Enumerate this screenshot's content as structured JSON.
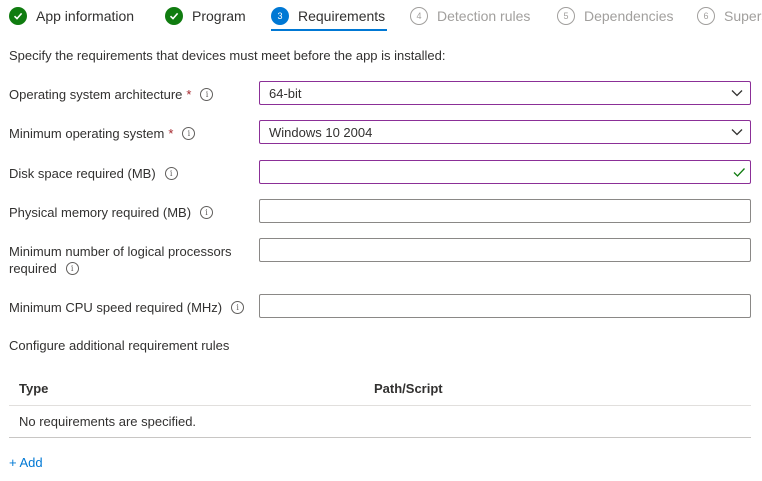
{
  "wizard": {
    "steps": [
      {
        "label": "App information",
        "state": "done",
        "icon": "checkmark-icon"
      },
      {
        "label": "Program",
        "state": "done",
        "icon": "checkmark-icon"
      },
      {
        "label": "Requirements",
        "state": "current",
        "number": "3"
      },
      {
        "label": "Detection rules",
        "state": "todo",
        "number": "4"
      },
      {
        "label": "Dependencies",
        "state": "todo",
        "number": "5"
      },
      {
        "label": "Supers",
        "state": "todo",
        "number": "6"
      }
    ]
  },
  "intro": "Specify the requirements that devices must meet before the app is installed:",
  "fields": {
    "os_arch": {
      "label": "Operating system architecture",
      "required": "*",
      "value": "64-bit"
    },
    "min_os": {
      "label": "Minimum operating system",
      "required": "*",
      "value": "Windows 10 2004"
    },
    "disk_space": {
      "label": "Disk space required (MB)",
      "value": ""
    },
    "memory": {
      "label": "Physical memory required (MB)",
      "value": ""
    },
    "processors": {
      "label_line1": "Minimum number of logical processors",
      "label_line2": "required",
      "value": ""
    },
    "cpu_speed": {
      "label": "Minimum CPU speed required (MHz)",
      "value": ""
    }
  },
  "info_glyph": "i",
  "rules": {
    "section_title": "Configure additional requirement rules",
    "columns": [
      "Type",
      "Path/Script"
    ],
    "empty_text": "No requirements are specified.",
    "add_label": "+ Add"
  },
  "colors": {
    "accent": "#0078d4",
    "success": "#107c10",
    "focus": "#8b2f97",
    "required": "#a4262c"
  }
}
